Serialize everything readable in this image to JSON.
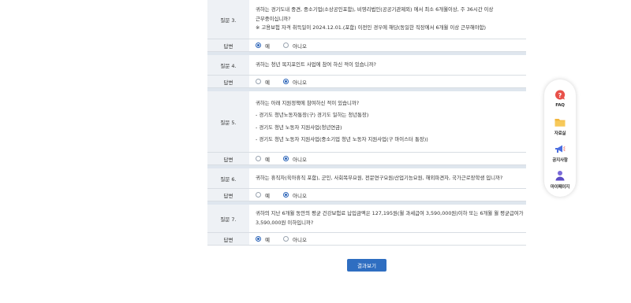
{
  "questions": [
    {
      "label": "질문 3.",
      "lines": [
        "귀하는 경기도내 중견, 중소기업(소상공인포함), 비영리법인(공공기관제외) 에서 최소 6개월이상, 주 36시간 이상",
        "근무중이십니까?",
        "※ 고용보험 자격 취득일이 2024.12.01.(포함) 이전인 경우에 해당(동일한 직장에서 6개월 이상 근무해야함)"
      ],
      "answer_label": "답변",
      "options": [
        "예",
        "아니오"
      ],
      "selected": "예"
    },
    {
      "label": "질문 4.",
      "lines": [
        "귀하는 청년 복지포인트 사업에 참여 하신 적이 있습니까?"
      ],
      "answer_label": "답변",
      "options": [
        "예",
        "아니오"
      ],
      "selected": "아니오"
    },
    {
      "label": "질문 5.",
      "lines": [
        "귀하는 아래 지원정책에 참여하신 적이 있습니까?",
        "- 경기도 청년노동자통장(구) 경기도 일하는 청년통장)",
        "- 경기도 청년 노동자 지원사업(청년연금)",
        "- 경기도 청년 노동자 지원사업(중소기업 청년 노동자 지원사업(구 마이스터 통장))"
      ],
      "answer_label": "답변",
      "options": [
        "예",
        "아니오"
      ],
      "selected": "아니오"
    },
    {
      "label": "질문 6.",
      "lines": [
        "귀하는 휴직자(육아휴직 포함), 군인, 사회복무요원, 전문연구요원/산업기능요원, 해외파견자, 국가근로장학생 입니까?"
      ],
      "answer_label": "답변",
      "options": [
        "예",
        "아니오"
      ],
      "selected": "아니오"
    },
    {
      "label": "질문 7.",
      "lines": [
        "귀하의 지난 6개월 동안의 평균 건강보험료 납입금액은 127,195원(월 과세급여 3,590,000원)이하 또는 6개월 월 평균급여가",
        "3,590,000원 이하입니까?"
      ],
      "answer_label": "답변",
      "options": [
        "예",
        "아니오"
      ],
      "selected": "예"
    }
  ],
  "result_button": "결과보기",
  "quick_menu": [
    {
      "label": "FAQ",
      "icon": "faq-icon"
    },
    {
      "label": "자료실",
      "icon": "folder-icon"
    },
    {
      "label": "공지사항",
      "icon": "megaphone-icon"
    },
    {
      "label": "마이페이지",
      "icon": "person-icon"
    }
  ],
  "colors": {
    "accent": "#2f6ec1",
    "label_bg": "#eef1f5",
    "separator": "#dfe6ee",
    "faq_icon": "#e8514a",
    "folder_icon": "#f2b63c",
    "megaphone_icon": "#4a6ee0",
    "person_icon": "#7a6ad8"
  }
}
